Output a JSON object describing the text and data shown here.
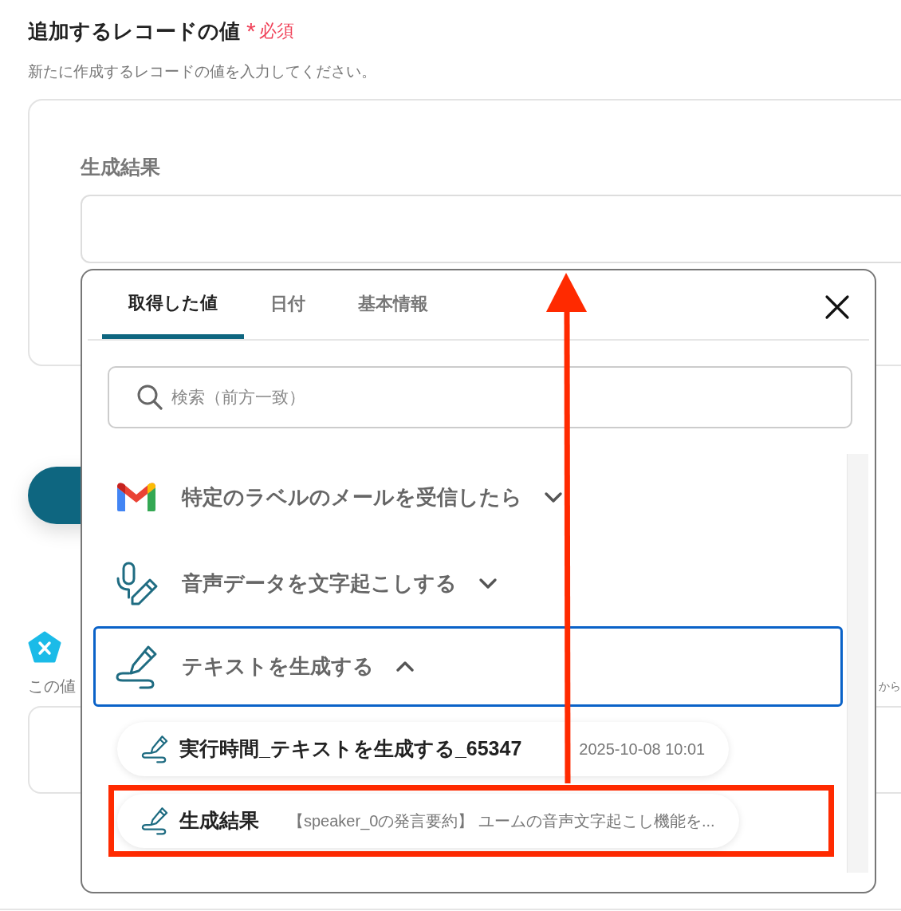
{
  "section": {
    "title": "追加するレコードの値",
    "required_mark": "*",
    "required_label": "必須",
    "description": "新たに作成するレコードの値を入力してください。"
  },
  "record_card": {
    "field_label": "生成結果"
  },
  "lower_section": {
    "left_text": "この値",
    "right_text": "から"
  },
  "popup": {
    "tabs": [
      {
        "label": "取得した値",
        "selected": true
      },
      {
        "label": "日付",
        "selected": false
      },
      {
        "label": "基本情報",
        "selected": false
      }
    ],
    "search": {
      "placeholder": "検索（前方一致）"
    },
    "groups": [
      {
        "kind": "gmail",
        "title": "特定のラベルのメールを受信したら",
        "expanded": false,
        "selected": false
      },
      {
        "kind": "mic",
        "title": "音声データを文字起こしする",
        "expanded": false,
        "selected": false
      },
      {
        "kind": "pen",
        "title": "テキストを生成する",
        "expanded": true,
        "selected": true,
        "children": [
          {
            "name": "実行時間_テキストを生成する_65347",
            "value": "2025-10-08 10:01",
            "highlighted": false
          },
          {
            "name": "生成結果",
            "value": "【speaker_0の発言要約】 ユームの音声文字起こし機能を...",
            "highlighted": true
          }
        ]
      }
    ]
  }
}
